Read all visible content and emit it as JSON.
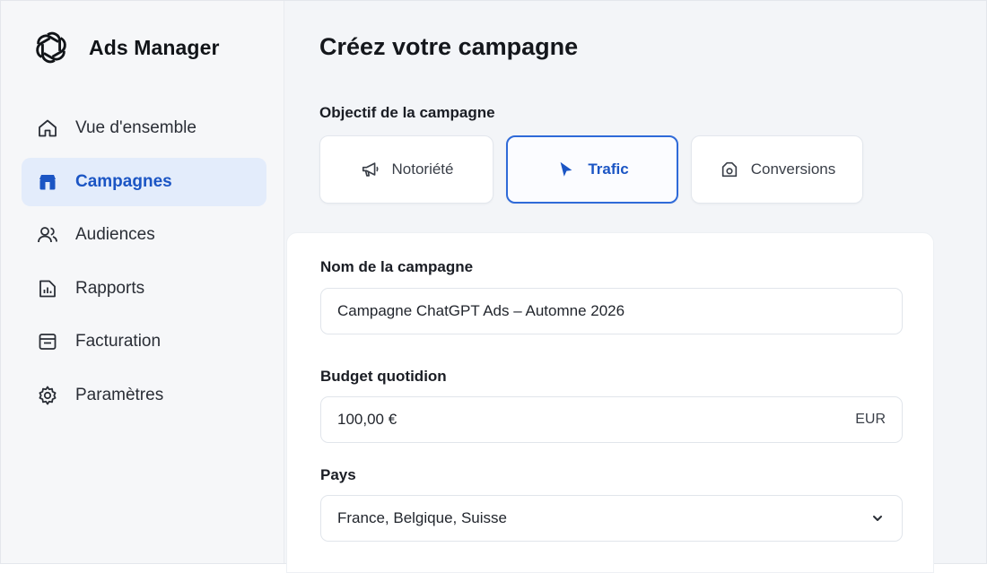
{
  "app": {
    "brand_name": "Ads Manager",
    "accent": "#1b55c4"
  },
  "sidebar": {
    "items": [
      {
        "label": "Vue d'ensemble",
        "icon": "home-icon"
      },
      {
        "label": "Campagnes",
        "icon": "megaphone-store-icon",
        "active": true
      },
      {
        "label": "Audiences",
        "icon": "users-icon"
      },
      {
        "label": "Rapports",
        "icon": "report-icon"
      },
      {
        "label": "Facturation",
        "icon": "billing-icon"
      },
      {
        "label": "Paramètres",
        "icon": "gear-icon"
      }
    ]
  },
  "main": {
    "title": "Créez votre campagne",
    "objective": {
      "label": "Objectif de la campagne",
      "options": [
        {
          "label": "Notoriété",
          "icon": "megaphone-icon"
        },
        {
          "label": "Trafic",
          "icon": "cursor-icon",
          "selected": true
        },
        {
          "label": "Conversions",
          "icon": "bag-icon"
        }
      ]
    },
    "form": {
      "name": {
        "label": "Nom de la campagne",
        "value": "Campagne ChatGPT Ads – Automne 2026"
      },
      "budget": {
        "label": "Budget quotidion",
        "value": "100,00 €",
        "currency": "EUR"
      },
      "country": {
        "label": "Pays",
        "value": "France, Belgique, Suisse"
      }
    }
  }
}
